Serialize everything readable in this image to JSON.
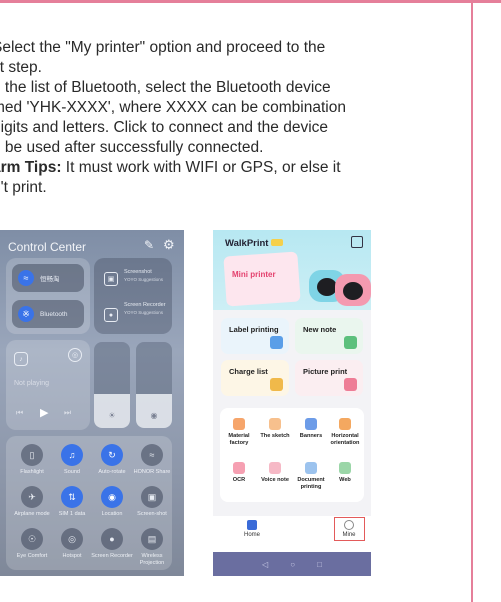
{
  "instructions": {
    "line1": "Select the \"My printer\" option and proceed to the",
    "line2": "xt step.",
    "line3": "n the list of Bluetooth, select the Bluetooth device",
    "line4": "med 'YHK-XXXX', where XXXX can be combination",
    "line5": "digits and letters. Click to connect and the device",
    "line6": "n be used after successfully connected.",
    "tips_label": "arm Tips:",
    "tips_text": " It must work with WIFI or GPS, or else it",
    "line8": "n't print."
  },
  "control_center": {
    "title": "Control Center",
    "wifi_label": "恒畅淘",
    "bluetooth_label": "Bluetooth",
    "screenshot_label": "Screenshot",
    "screenshot_sub": "YOYO Suggestions",
    "recorder_label": "Screen Recorder",
    "recorder_sub": "YOYO Suggestions",
    "not_playing": "Not playing",
    "grid": [
      {
        "label": "Flashlight",
        "icon": "flashlight-icon",
        "on": false
      },
      {
        "label": "Sound",
        "icon": "bell-icon",
        "on": true
      },
      {
        "label": "Auto-rotate",
        "icon": "rotate-icon",
        "on": true
      },
      {
        "label": "HONOR Share",
        "icon": "share-icon",
        "on": false
      },
      {
        "label": "Airplane mode",
        "icon": "airplane-icon",
        "on": false
      },
      {
        "label": "SIM 1 data",
        "icon": "data-icon",
        "on": true
      },
      {
        "label": "Location",
        "icon": "location-icon",
        "on": true
      },
      {
        "label": "Screen-shot",
        "icon": "screenshot-icon",
        "on": false
      },
      {
        "label": "Eye Comfort",
        "icon": "eye-icon",
        "on": false
      },
      {
        "label": "Hotspot",
        "icon": "hotspot-icon",
        "on": false
      },
      {
        "label": "Screen Recorder",
        "icon": "record-icon",
        "on": false
      },
      {
        "label": "Wireless Projection",
        "icon": "projection-icon",
        "on": false
      }
    ]
  },
  "app": {
    "title": "WalkPrint",
    "banner_text": "Mini printer",
    "cards": [
      "Label printing",
      "New note",
      "Charge list",
      "Picture print"
    ],
    "tools": [
      "Material factory",
      "The sketch",
      "Banners",
      "Horizontal orientation",
      "OCR",
      "Voice note",
      "Document printing",
      "Web"
    ],
    "tabs": {
      "home": "Home",
      "mine": "Mine"
    },
    "colors": {
      "accent_pink": "#e4416e",
      "header": "#b7e8f2",
      "nav": "#6a6ea0"
    }
  },
  "frame_color": "#e57f9a"
}
